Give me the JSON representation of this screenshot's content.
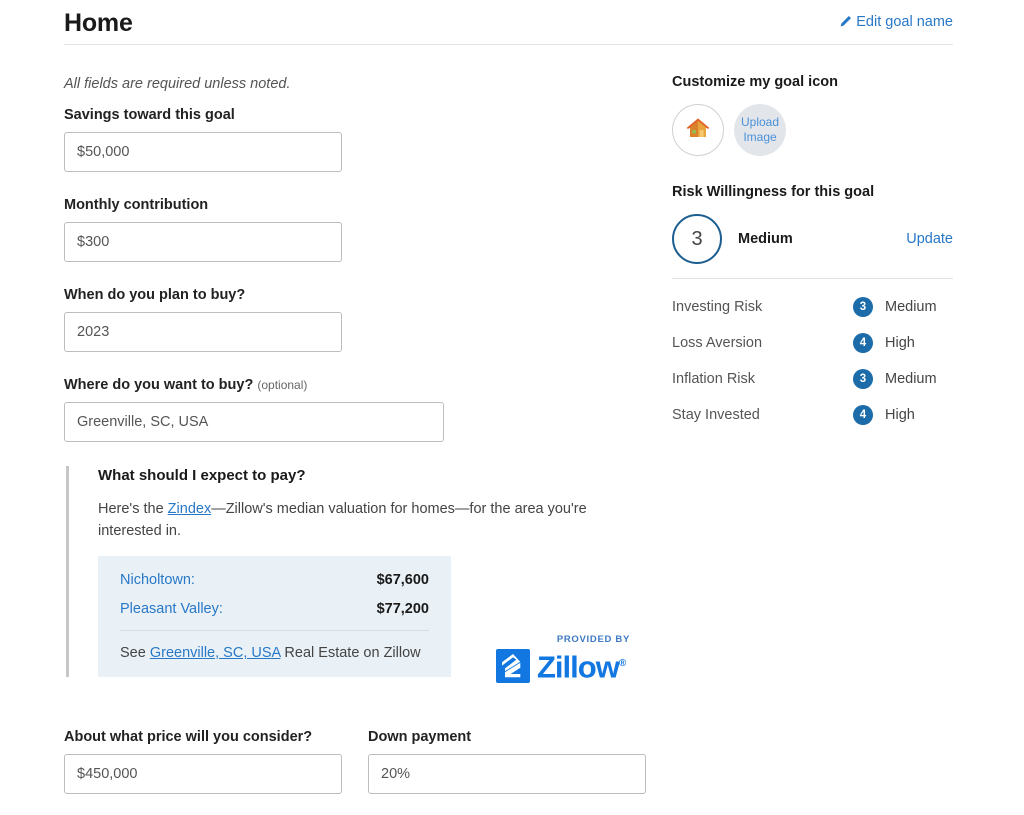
{
  "header": {
    "title": "Home",
    "edit_link": "Edit goal name",
    "edit_icon": "pencil-icon"
  },
  "form": {
    "required_note": "All fields are required unless noted.",
    "fields": [
      {
        "label": "Savings toward this goal",
        "value": "$50,000",
        "optional": ""
      },
      {
        "label": "Monthly contribution",
        "value": "$300",
        "optional": ""
      },
      {
        "label": "When do you plan to buy?",
        "value": "2023",
        "optional": ""
      },
      {
        "label": "Where do you want to buy?",
        "value": "Greenville, SC, USA",
        "optional": "(optional)"
      }
    ],
    "price_field": {
      "label": "About what price will you consider?",
      "value": "$450,000"
    },
    "down_payment_field": {
      "label": "Down payment",
      "value": "20%"
    }
  },
  "callout": {
    "title": "What should I expect to pay?",
    "text_before_link": "Here's the ",
    "link_text": "Zindex",
    "text_after_link": "—Zillow's median valuation for homes—for the area you're interested in.",
    "rows": [
      {
        "name": "Nicholtown:",
        "value": "$67,600"
      },
      {
        "name": "Pleasant Valley:",
        "value": "$77,200"
      }
    ],
    "footer_before": "See ",
    "footer_link": "Greenville, SC, USA",
    "footer_after": " Real Estate on Zillow",
    "logo": {
      "provided_by": "PROVIDED BY",
      "brand": "Zillow",
      "trademark": "®"
    }
  },
  "goal_icon": {
    "section_title": "Customize my goal icon",
    "current_icon": "house-icon",
    "upload_line1": "Upload",
    "upload_line2": "Image"
  },
  "risk": {
    "section_title": "Risk Willingness for this goal",
    "score": "3",
    "level": "Medium",
    "update_label": "Update",
    "items": [
      {
        "name": "Investing Risk",
        "score": "3",
        "level": "Medium"
      },
      {
        "name": "Loss Aversion",
        "score": "4",
        "level": "High"
      },
      {
        "name": "Inflation Risk",
        "score": "3",
        "level": "Medium"
      },
      {
        "name": "Stay Invested",
        "score": "4",
        "level": "High"
      }
    ]
  },
  "colors": {
    "link_blue": "#2878c8",
    "badge_blue": "#1b6ca8",
    "ring_blue": "#1b5e8f",
    "zillow_blue": "#1277e1",
    "callout_bg": "#eaf1f6"
  }
}
